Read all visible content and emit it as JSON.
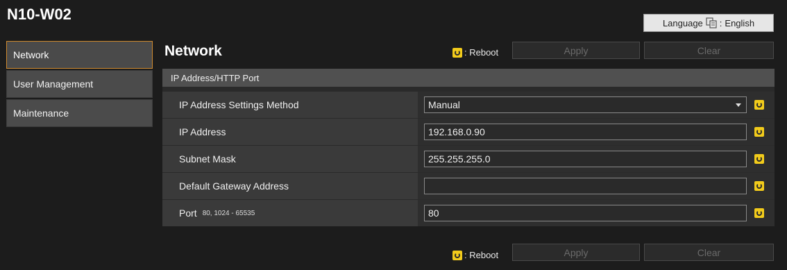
{
  "app": {
    "title": "N10-W02"
  },
  "language": {
    "label": "Language",
    "icon": "language-icon",
    "value": "English"
  },
  "sidebar": {
    "items": [
      {
        "label": "Network",
        "active": true
      },
      {
        "label": "User Management",
        "active": false
      },
      {
        "label": "Maintenance",
        "active": false
      }
    ]
  },
  "page": {
    "title": "Network"
  },
  "legend": {
    "reboot_label": ": Reboot",
    "icon": "reboot-icon",
    "color": "#f2cb1b"
  },
  "buttons": {
    "apply": "Apply",
    "clear": "Clear"
  },
  "section": {
    "title": "IP Address/HTTP Port",
    "rows": [
      {
        "label": "IP Address Settings Method",
        "hint": "",
        "value": "Manual",
        "type": "select"
      },
      {
        "label": "IP Address",
        "hint": "",
        "value": "192.168.0.90",
        "type": "text"
      },
      {
        "label": "Subnet Mask",
        "hint": "",
        "value": "255.255.255.0",
        "type": "text"
      },
      {
        "label": "Default Gateway Address",
        "hint": "",
        "value": "",
        "type": "text"
      },
      {
        "label": "Port",
        "hint": "80, 1024 - 65535",
        "value": "80",
        "type": "text"
      }
    ]
  },
  "colors": {
    "accent": "#d08a2e",
    "background": "#1c1c1c"
  }
}
